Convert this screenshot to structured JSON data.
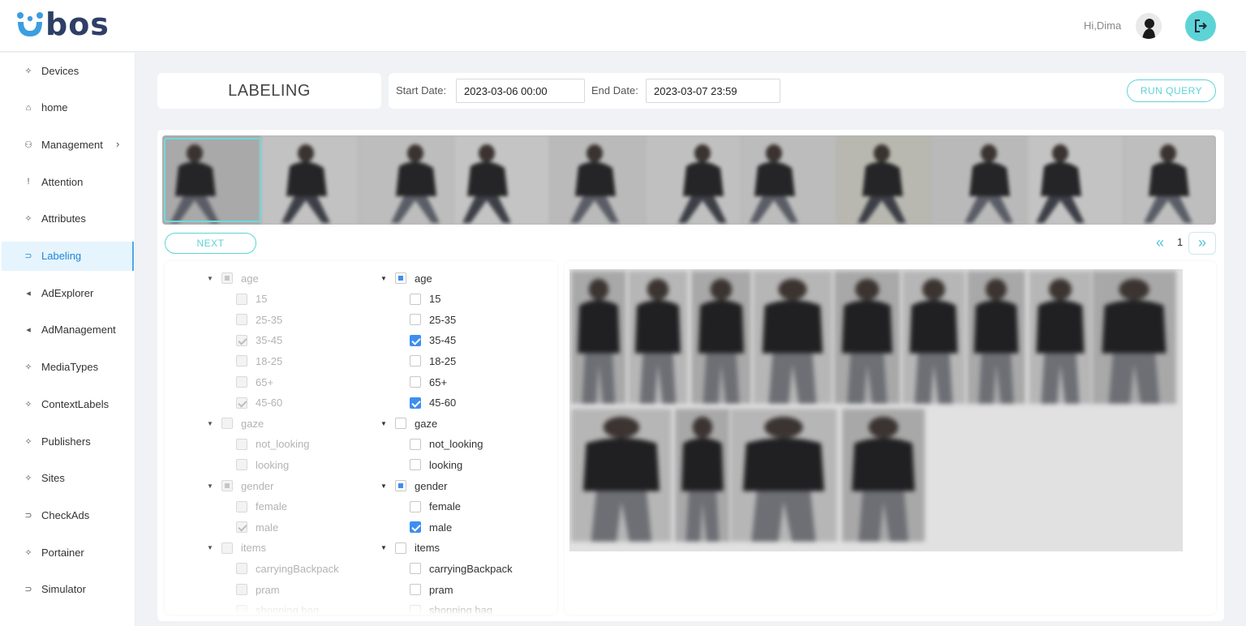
{
  "app": {
    "logo_text": "bos",
    "greeting": "Hi,Dima",
    "accent": "#5ed3d6"
  },
  "sidebar": {
    "items": [
      {
        "label": "Devices",
        "icon": "sparkle-icon"
      },
      {
        "label": "home",
        "icon": "home-icon"
      },
      {
        "label": "Management",
        "icon": "users-icon",
        "has_submenu": true
      },
      {
        "label": "Attention",
        "icon": "exclamation-icon"
      },
      {
        "label": "Attributes",
        "icon": "sparkle-icon"
      },
      {
        "label": "Labeling",
        "icon": "tag-icon",
        "active": true
      },
      {
        "label": "AdExplorer",
        "icon": "megaphone-icon"
      },
      {
        "label": "AdManagement",
        "icon": "megaphone-icon"
      },
      {
        "label": "MediaTypes",
        "icon": "sparkle-icon"
      },
      {
        "label": "ContextLabels",
        "icon": "sparkle-icon"
      },
      {
        "label": "Publishers",
        "icon": "sparkle-icon"
      },
      {
        "label": "Sites",
        "icon": "sparkle-icon"
      },
      {
        "label": "CheckAds",
        "icon": "tag-icon"
      },
      {
        "label": "Portainer",
        "icon": "sparkle-icon"
      },
      {
        "label": "Simulator",
        "icon": "tag-icon"
      }
    ]
  },
  "page": {
    "title": "LABELING"
  },
  "query": {
    "start_label": "Start Date:",
    "start_value": "2023-03-06 00:00",
    "end_label": "End Date:",
    "end_value": "2023-03-07 23:59",
    "run_label": "RUN QUERY"
  },
  "strip": {
    "selected_index": 0,
    "thumbnail_count": 11
  },
  "controls": {
    "next_label": "NEXT"
  },
  "pagination": {
    "current_page": "1",
    "prev_icon": "double-chevron-left-icon",
    "next_icon": "double-chevron-right-icon"
  },
  "label_trees": [
    {
      "disabled": true,
      "groups": [
        {
          "name": "age",
          "state": "partial",
          "options": [
            {
              "label": "15",
              "checked": false
            },
            {
              "label": "25-35",
              "checked": false
            },
            {
              "label": "35-45",
              "checked": true
            },
            {
              "label": "18-25",
              "checked": false
            },
            {
              "label": "65+",
              "checked": false
            },
            {
              "label": "45-60",
              "checked": true
            }
          ]
        },
        {
          "name": "gaze",
          "state": "none",
          "options": [
            {
              "label": "not_looking",
              "checked": false
            },
            {
              "label": "looking",
              "checked": false
            }
          ]
        },
        {
          "name": "gender",
          "state": "partial",
          "options": [
            {
              "label": "female",
              "checked": false
            },
            {
              "label": "male",
              "checked": true
            }
          ]
        },
        {
          "name": "items",
          "state": "none",
          "options": [
            {
              "label": "carryingBackpack",
              "checked": false
            },
            {
              "label": "pram",
              "checked": false
            },
            {
              "label": "shopping bag",
              "checked": false
            }
          ]
        }
      ]
    },
    {
      "disabled": false,
      "groups": [
        {
          "name": "age",
          "state": "partial",
          "options": [
            {
              "label": "15",
              "checked": false
            },
            {
              "label": "25-35",
              "checked": false
            },
            {
              "label": "35-45",
              "checked": true
            },
            {
              "label": "18-25",
              "checked": false
            },
            {
              "label": "65+",
              "checked": false
            },
            {
              "label": "45-60",
              "checked": true
            }
          ]
        },
        {
          "name": "gaze",
          "state": "none",
          "options": [
            {
              "label": "not_looking",
              "checked": false
            },
            {
              "label": "looking",
              "checked": false
            }
          ]
        },
        {
          "name": "gender",
          "state": "partial",
          "options": [
            {
              "label": "female",
              "checked": false
            },
            {
              "label": "male",
              "checked": true
            }
          ]
        },
        {
          "name": "items",
          "state": "none",
          "options": [
            {
              "label": "carryingBackpack",
              "checked": false
            },
            {
              "label": "pram",
              "checked": false
            },
            {
              "label": "shopping bag",
              "checked": false
            }
          ]
        }
      ]
    }
  ],
  "crops": {
    "count": 13
  }
}
